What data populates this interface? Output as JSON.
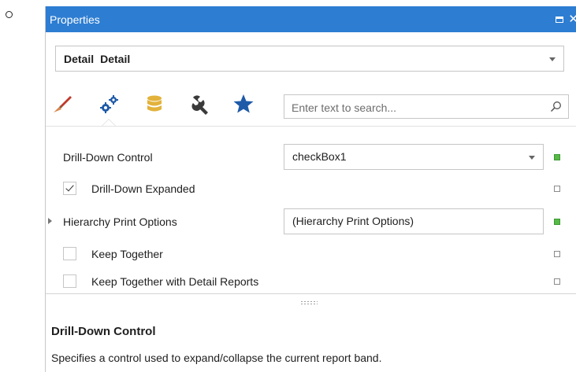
{
  "bullet": "o",
  "panel": {
    "title": "Properties",
    "maximize_icon": "maximize-icon",
    "close_glyph": "✕"
  },
  "object_selector": {
    "name": "Detail",
    "type": "Detail"
  },
  "tabs": [
    {
      "name": "appearance",
      "icon": "brush-icon",
      "color": "#d8874f"
    },
    {
      "name": "behavior",
      "icon": "gears-icon",
      "color": "#1e5aa8",
      "active": true
    },
    {
      "name": "data",
      "icon": "database-icon",
      "color": "#e2b23a"
    },
    {
      "name": "design",
      "icon": "wrench-icon",
      "color": "#3a3a3a"
    },
    {
      "name": "favorites",
      "icon": "star-icon",
      "color": "#1e5aa8"
    }
  ],
  "search": {
    "placeholder": "Enter text to search...",
    "value": ""
  },
  "properties": [
    {
      "label": "Drill-Down Control",
      "value": "checkBox1",
      "has_dropdown": true,
      "marker": "set"
    },
    {
      "label": "Drill-Down Expanded",
      "checkbox": true,
      "checked": true,
      "marker": "default"
    },
    {
      "label": "Hierarchy Print Options",
      "value": "(Hierarchy Print Options)",
      "expandable": true,
      "marker": "set"
    },
    {
      "label": "Keep Together",
      "checkbox": true,
      "checked": false,
      "marker": "default"
    },
    {
      "label": "Keep Together with Detail Reports",
      "checkbox": true,
      "checked": false,
      "marker": "default"
    }
  ],
  "description": {
    "title": "Drill-Down Control",
    "text": "Specifies a control used to expand/collapse the current report band."
  },
  "colors": {
    "titlebar": "#2d7dd2",
    "set_marker": "#58b947"
  }
}
